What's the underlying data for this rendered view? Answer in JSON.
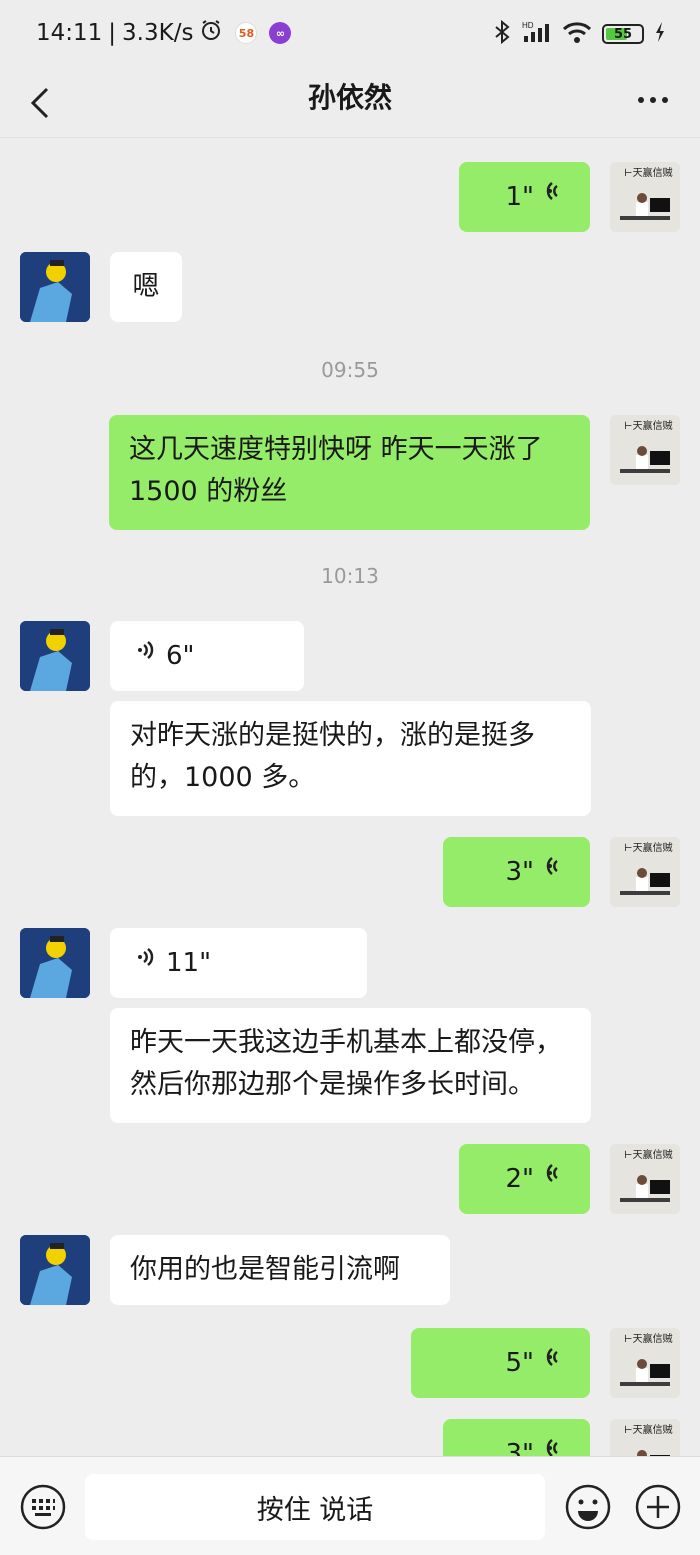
{
  "status": {
    "time": "14:11",
    "speed": "3.3K/s",
    "badge_58": "58",
    "battery": "55"
  },
  "nav": {
    "title": "孙依然"
  },
  "messages": {
    "m1": {
      "duration": "1\""
    },
    "m2": {
      "text": "嗯"
    },
    "t1": "09:55",
    "m3": {
      "text": "这几天速度特别快呀  昨天一天涨了1500 的粉丝"
    },
    "t2": "10:13",
    "m4": {
      "duration": "6\""
    },
    "m5": {
      "text": "对昨天涨的是挺快的，涨的是挺多的，1000 多。"
    },
    "m6": {
      "duration": "3\""
    },
    "m7": {
      "duration": "11\""
    },
    "m8": {
      "text": "昨天一天我这边手机基本上都没停，然后你那边那个是操作多长时间。"
    },
    "m9": {
      "duration": "2\""
    },
    "m10": {
      "text": "你用的也是智能引流啊"
    },
    "m11": {
      "duration": "5\""
    },
    "m12": {
      "duration": "3\""
    }
  },
  "bottom": {
    "talk_label": "按住 说话"
  },
  "colors": {
    "my_bubble": "#95ec69",
    "their_bubble": "#ffffff",
    "background": "#ededed"
  }
}
